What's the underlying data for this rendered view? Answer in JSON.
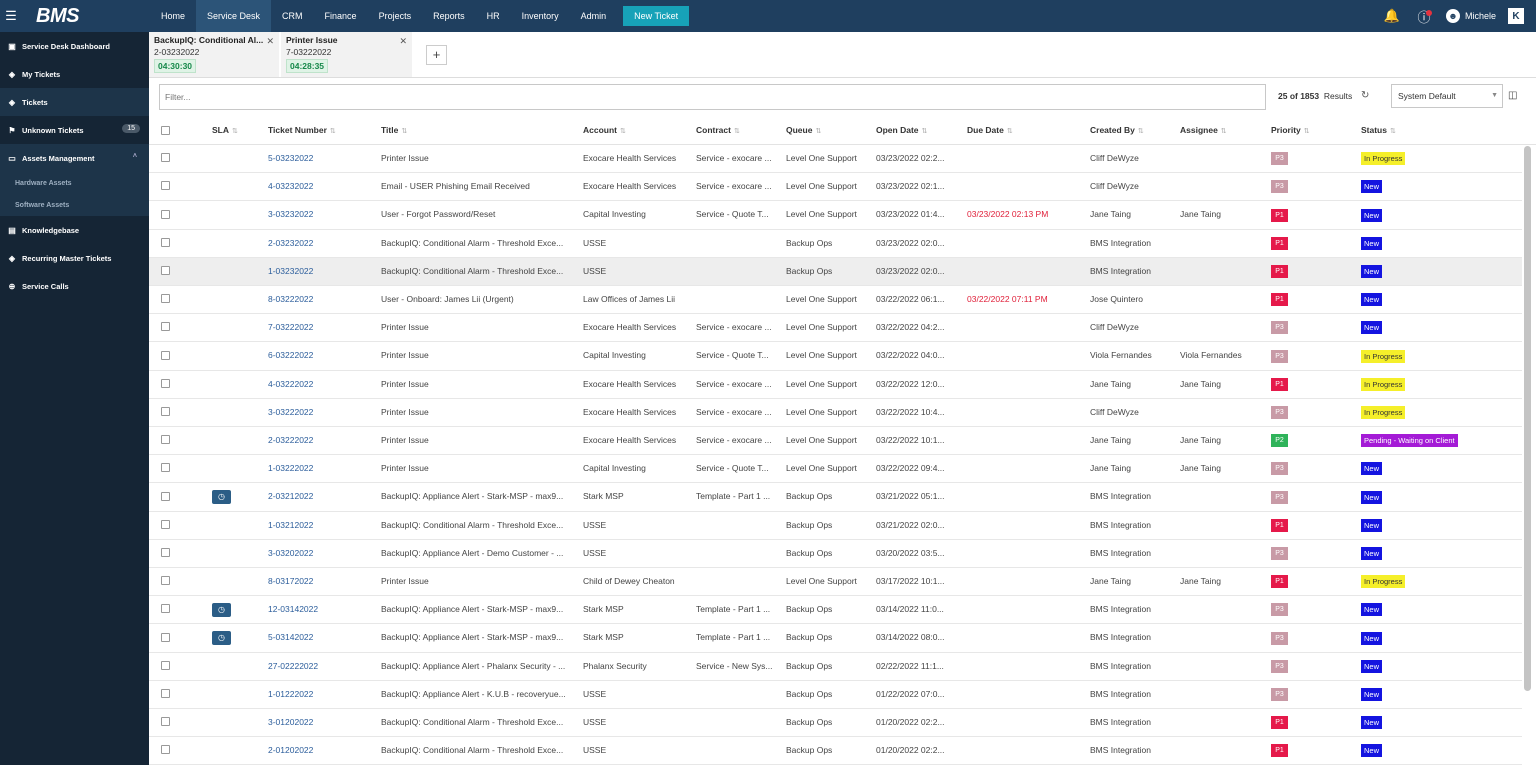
{
  "app": {
    "logo": "BMS"
  },
  "nav": {
    "items": [
      "Home",
      "Service Desk",
      "CRM",
      "Finance",
      "Projects",
      "Reports",
      "HR",
      "Inventory",
      "Admin"
    ],
    "active": "Service Desk",
    "new_ticket": "New Ticket",
    "user": "Michele",
    "k_label": "K"
  },
  "sidebar": {
    "items": [
      {
        "label": "Service Desk Dashboard",
        "icon": "dashboard-icon"
      },
      {
        "label": "My Tickets",
        "icon": "ticket-icon"
      },
      {
        "label": "Tickets",
        "icon": "ticket-icon"
      },
      {
        "label": "Unknown Tickets",
        "icon": "flag-icon",
        "badge": "15"
      },
      {
        "label": "Assets Management",
        "icon": "monitor-icon"
      },
      {
        "label": "Knowledgebase",
        "icon": "book-icon"
      },
      {
        "label": "Recurring Master Tickets",
        "icon": "ticket-icon"
      },
      {
        "label": "Service Calls",
        "icon": "lifebuoy-icon"
      }
    ],
    "sub_items": [
      "Hardware Assets",
      "Software Assets"
    ]
  },
  "tabs": [
    {
      "title": "BackupIQ: Conditional Al...",
      "number": "2-03232022",
      "timer": "04:30:30"
    },
    {
      "title": "Printer Issue",
      "number": "7-03222022",
      "timer": "04:28:35"
    }
  ],
  "toolbar": {
    "filter_placeholder": "Filter...",
    "results_count": "25 of 1853",
    "results_label": "Results",
    "view_select": "System Default"
  },
  "table": {
    "headers": [
      "SLA",
      "Ticket Number",
      "Title",
      "Account",
      "Contract",
      "Queue",
      "Open Date",
      "Due Date",
      "Created By",
      "Assignee",
      "Priority",
      "Status"
    ],
    "rows": [
      {
        "sla": false,
        "num": "5-03232022",
        "title": "Printer Issue",
        "account": "Exocare Health Services",
        "contract": "Service - exocare ...",
        "queue": "Level One Support",
        "open": "03/23/2022 02:2...",
        "due": "",
        "created": "Cliff DeWyze",
        "assignee": "",
        "priority": "P3",
        "status": "In Progress"
      },
      {
        "sla": false,
        "num": "4-03232022",
        "title": "Email - USER Phishing Email Received",
        "account": "Exocare Health Services",
        "contract": "Service - exocare ...",
        "queue": "Level One Support",
        "open": "03/23/2022 02:1...",
        "due": "",
        "created": "Cliff DeWyze",
        "assignee": "",
        "priority": "P3",
        "status": "New"
      },
      {
        "sla": false,
        "num": "3-03232022",
        "title": "User - Forgot Password/Reset",
        "account": "Capital Investing",
        "contract": "Service - Quote T...",
        "queue": "Level One Support",
        "open": "03/23/2022 01:4...",
        "due": "03/23/2022 02:13 PM",
        "created": "Jane Taing",
        "assignee": "Jane Taing",
        "priority": "P1",
        "status": "New"
      },
      {
        "sla": false,
        "num": "2-03232022",
        "title": "BackupIQ: Conditional Alarm - Threshold Exce...",
        "account": "USSE",
        "contract": "",
        "queue": "Backup Ops",
        "open": "03/23/2022 02:0...",
        "due": "",
        "created": "BMS Integration",
        "assignee": "",
        "priority": "P1",
        "status": "New"
      },
      {
        "sla": false,
        "num": "1-03232022",
        "title": "BackupIQ: Conditional Alarm - Threshold Exce...",
        "account": "USSE",
        "contract": "",
        "queue": "Backup Ops",
        "open": "03/23/2022 02:0...",
        "due": "",
        "created": "BMS Integration",
        "assignee": "",
        "priority": "P1",
        "status": "New"
      },
      {
        "sla": false,
        "num": "8-03222022",
        "title": "User - Onboard: James Lii (Urgent)",
        "account": "Law Offices of James Lii",
        "contract": "",
        "queue": "Level One Support",
        "open": "03/22/2022 06:1...",
        "due": "03/22/2022 07:11 PM",
        "created": "Jose Quintero",
        "assignee": "",
        "priority": "P1",
        "status": "New"
      },
      {
        "sla": false,
        "num": "7-03222022",
        "title": "Printer Issue",
        "account": "Exocare Health Services",
        "contract": "Service - exocare ...",
        "queue": "Level One Support",
        "open": "03/22/2022 04:2...",
        "due": "",
        "created": "Cliff DeWyze",
        "assignee": "",
        "priority": "P3",
        "status": "New"
      },
      {
        "sla": false,
        "num": "6-03222022",
        "title": "Printer Issue",
        "account": "Capital Investing",
        "contract": "Service - Quote T...",
        "queue": "Level One Support",
        "open": "03/22/2022 04:0...",
        "due": "",
        "created": "Viola Fernandes",
        "assignee": "Viola Fernandes",
        "priority": "P3",
        "status": "In Progress"
      },
      {
        "sla": false,
        "num": "4-03222022",
        "title": "Printer Issue",
        "account": "Exocare Health Services",
        "contract": "Service - exocare ...",
        "queue": "Level One Support",
        "open": "03/22/2022 12:0...",
        "due": "",
        "created": "Jane Taing",
        "assignee": "Jane Taing",
        "priority": "P1",
        "status": "In Progress"
      },
      {
        "sla": false,
        "num": "3-03222022",
        "title": "Printer Issue",
        "account": "Exocare Health Services",
        "contract": "Service - exocare ...",
        "queue": "Level One Support",
        "open": "03/22/2022 10:4...",
        "due": "",
        "created": "Cliff DeWyze",
        "assignee": "",
        "priority": "P3",
        "status": "In Progress"
      },
      {
        "sla": false,
        "num": "2-03222022",
        "title": "Printer Issue",
        "account": "Exocare Health Services",
        "contract": "Service - exocare ...",
        "queue": "Level One Support",
        "open": "03/22/2022 10:1...",
        "due": "",
        "created": "Jane Taing",
        "assignee": "Jane Taing",
        "priority": "P2",
        "status": "Pending - Waiting on Client"
      },
      {
        "sla": false,
        "num": "1-03222022",
        "title": "Printer Issue",
        "account": "Capital Investing",
        "contract": "Service - Quote T...",
        "queue": "Level One Support",
        "open": "03/22/2022 09:4...",
        "due": "",
        "created": "Jane Taing",
        "assignee": "Jane Taing",
        "priority": "P3",
        "status": "New"
      },
      {
        "sla": true,
        "num": "2-03212022",
        "title": "BackupIQ: Appliance Alert - Stark-MSP - max9...",
        "account": "Stark MSP",
        "contract": "Template - Part 1 ...",
        "queue": "Backup Ops",
        "open": "03/21/2022 05:1...",
        "due": "",
        "created": "BMS Integration",
        "assignee": "",
        "priority": "P3",
        "status": "New"
      },
      {
        "sla": false,
        "num": "1-03212022",
        "title": "BackupIQ: Conditional Alarm - Threshold Exce...",
        "account": "USSE",
        "contract": "",
        "queue": "Backup Ops",
        "open": "03/21/2022 02:0...",
        "due": "",
        "created": "BMS Integration",
        "assignee": "",
        "priority": "P1",
        "status": "New"
      },
      {
        "sla": false,
        "num": "3-03202022",
        "title": "BackupIQ: Appliance Alert - Demo Customer - ...",
        "account": "USSE",
        "contract": "",
        "queue": "Backup Ops",
        "open": "03/20/2022 03:5...",
        "due": "",
        "created": "BMS Integration",
        "assignee": "",
        "priority": "P3",
        "status": "New"
      },
      {
        "sla": false,
        "num": "8-03172022",
        "title": "Printer Issue",
        "account": "Child of Dewey Cheaton",
        "contract": "",
        "queue": "Level One Support",
        "open": "03/17/2022 10:1...",
        "due": "",
        "created": "Jane Taing",
        "assignee": "Jane Taing",
        "priority": "P1",
        "status": "In Progress"
      },
      {
        "sla": true,
        "num": "12-03142022",
        "title": "BackupIQ: Appliance Alert - Stark-MSP - max9...",
        "account": "Stark MSP",
        "contract": "Template - Part 1 ...",
        "queue": "Backup Ops",
        "open": "03/14/2022 11:0...",
        "due": "",
        "created": "BMS Integration",
        "assignee": "",
        "priority": "P3",
        "status": "New"
      },
      {
        "sla": true,
        "num": "5-03142022",
        "title": "BackupIQ: Appliance Alert - Stark-MSP - max9...",
        "account": "Stark MSP",
        "contract": "Template - Part 1 ...",
        "queue": "Backup Ops",
        "open": "03/14/2022 08:0...",
        "due": "",
        "created": "BMS Integration",
        "assignee": "",
        "priority": "P3",
        "status": "New"
      },
      {
        "sla": false,
        "num": "27-02222022",
        "title": "BackupIQ: Appliance Alert - Phalanx Security - ...",
        "account": "Phalanx Security",
        "contract": "Service - New Sys...",
        "queue": "Backup Ops",
        "open": "02/22/2022 11:1...",
        "due": "",
        "created": "BMS Integration",
        "assignee": "",
        "priority": "P3",
        "status": "New"
      },
      {
        "sla": false,
        "num": "1-01222022",
        "title": "BackupIQ: Appliance Alert - K.U.B - recoveryue...",
        "account": "USSE",
        "contract": "",
        "queue": "Backup Ops",
        "open": "01/22/2022 07:0...",
        "due": "",
        "created": "BMS Integration",
        "assignee": "",
        "priority": "P3",
        "status": "New"
      },
      {
        "sla": false,
        "num": "3-01202022",
        "title": "BackupIQ: Conditional Alarm - Threshold Exce...",
        "account": "USSE",
        "contract": "",
        "queue": "Backup Ops",
        "open": "01/20/2022 02:2...",
        "due": "",
        "created": "BMS Integration",
        "assignee": "",
        "priority": "P1",
        "status": "New"
      },
      {
        "sla": false,
        "num": "2-01202022",
        "title": "BackupIQ: Conditional Alarm - Threshold Exce...",
        "account": "USSE",
        "contract": "",
        "queue": "Backup Ops",
        "open": "01/20/2022 02:2...",
        "due": "",
        "created": "BMS Integration",
        "assignee": "",
        "priority": "P1",
        "status": "New"
      }
    ],
    "highlighted_row": 4
  },
  "colors": {
    "topbar": "#1f3f5f",
    "sidebar": "#152535",
    "accent": "#17a2b8",
    "p1": "#e5194a",
    "p2": "#2fb35a",
    "p3": "#c89aa6",
    "status_new": "#1414e0",
    "status_in_progress": "#f5ef2a",
    "status_pending": "#a41bd6"
  }
}
